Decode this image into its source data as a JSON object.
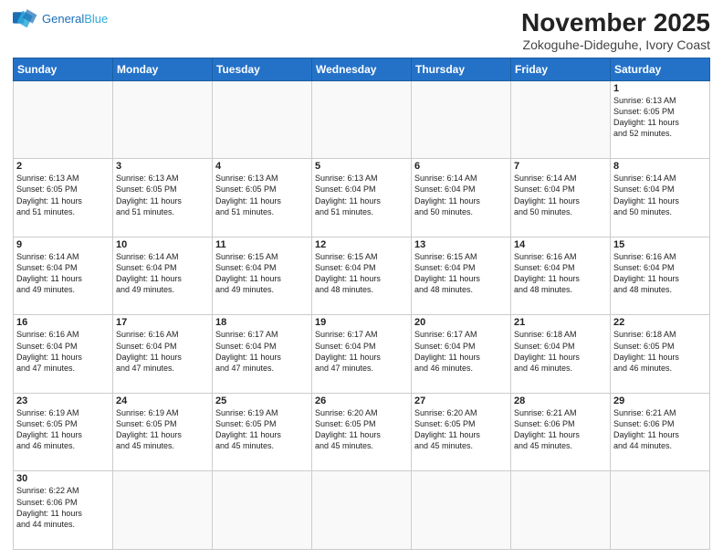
{
  "header": {
    "logo_line1": "General",
    "logo_line2": "Blue",
    "title": "November 2025",
    "subtitle": "Zokoguhe-Dideguhe, Ivory Coast"
  },
  "weekdays": [
    "Sunday",
    "Monday",
    "Tuesday",
    "Wednesday",
    "Thursday",
    "Friday",
    "Saturday"
  ],
  "weeks": [
    [
      {
        "day": "",
        "info": ""
      },
      {
        "day": "",
        "info": ""
      },
      {
        "day": "",
        "info": ""
      },
      {
        "day": "",
        "info": ""
      },
      {
        "day": "",
        "info": ""
      },
      {
        "day": "",
        "info": ""
      },
      {
        "day": "1",
        "info": "Sunrise: 6:13 AM\nSunset: 6:05 PM\nDaylight: 11 hours\nand 52 minutes."
      }
    ],
    [
      {
        "day": "2",
        "info": "Sunrise: 6:13 AM\nSunset: 6:05 PM\nDaylight: 11 hours\nand 51 minutes."
      },
      {
        "day": "3",
        "info": "Sunrise: 6:13 AM\nSunset: 6:05 PM\nDaylight: 11 hours\nand 51 minutes."
      },
      {
        "day": "4",
        "info": "Sunrise: 6:13 AM\nSunset: 6:05 PM\nDaylight: 11 hours\nand 51 minutes."
      },
      {
        "day": "5",
        "info": "Sunrise: 6:13 AM\nSunset: 6:04 PM\nDaylight: 11 hours\nand 51 minutes."
      },
      {
        "day": "6",
        "info": "Sunrise: 6:14 AM\nSunset: 6:04 PM\nDaylight: 11 hours\nand 50 minutes."
      },
      {
        "day": "7",
        "info": "Sunrise: 6:14 AM\nSunset: 6:04 PM\nDaylight: 11 hours\nand 50 minutes."
      },
      {
        "day": "8",
        "info": "Sunrise: 6:14 AM\nSunset: 6:04 PM\nDaylight: 11 hours\nand 50 minutes."
      }
    ],
    [
      {
        "day": "9",
        "info": "Sunrise: 6:14 AM\nSunset: 6:04 PM\nDaylight: 11 hours\nand 49 minutes."
      },
      {
        "day": "10",
        "info": "Sunrise: 6:14 AM\nSunset: 6:04 PM\nDaylight: 11 hours\nand 49 minutes."
      },
      {
        "day": "11",
        "info": "Sunrise: 6:15 AM\nSunset: 6:04 PM\nDaylight: 11 hours\nand 49 minutes."
      },
      {
        "day": "12",
        "info": "Sunrise: 6:15 AM\nSunset: 6:04 PM\nDaylight: 11 hours\nand 48 minutes."
      },
      {
        "day": "13",
        "info": "Sunrise: 6:15 AM\nSunset: 6:04 PM\nDaylight: 11 hours\nand 48 minutes."
      },
      {
        "day": "14",
        "info": "Sunrise: 6:16 AM\nSunset: 6:04 PM\nDaylight: 11 hours\nand 48 minutes."
      },
      {
        "day": "15",
        "info": "Sunrise: 6:16 AM\nSunset: 6:04 PM\nDaylight: 11 hours\nand 48 minutes."
      }
    ],
    [
      {
        "day": "16",
        "info": "Sunrise: 6:16 AM\nSunset: 6:04 PM\nDaylight: 11 hours\nand 47 minutes."
      },
      {
        "day": "17",
        "info": "Sunrise: 6:16 AM\nSunset: 6:04 PM\nDaylight: 11 hours\nand 47 minutes."
      },
      {
        "day": "18",
        "info": "Sunrise: 6:17 AM\nSunset: 6:04 PM\nDaylight: 11 hours\nand 47 minutes."
      },
      {
        "day": "19",
        "info": "Sunrise: 6:17 AM\nSunset: 6:04 PM\nDaylight: 11 hours\nand 47 minutes."
      },
      {
        "day": "20",
        "info": "Sunrise: 6:17 AM\nSunset: 6:04 PM\nDaylight: 11 hours\nand 46 minutes."
      },
      {
        "day": "21",
        "info": "Sunrise: 6:18 AM\nSunset: 6:04 PM\nDaylight: 11 hours\nand 46 minutes."
      },
      {
        "day": "22",
        "info": "Sunrise: 6:18 AM\nSunset: 6:05 PM\nDaylight: 11 hours\nand 46 minutes."
      }
    ],
    [
      {
        "day": "23",
        "info": "Sunrise: 6:19 AM\nSunset: 6:05 PM\nDaylight: 11 hours\nand 46 minutes."
      },
      {
        "day": "24",
        "info": "Sunrise: 6:19 AM\nSunset: 6:05 PM\nDaylight: 11 hours\nand 45 minutes."
      },
      {
        "day": "25",
        "info": "Sunrise: 6:19 AM\nSunset: 6:05 PM\nDaylight: 11 hours\nand 45 minutes."
      },
      {
        "day": "26",
        "info": "Sunrise: 6:20 AM\nSunset: 6:05 PM\nDaylight: 11 hours\nand 45 minutes."
      },
      {
        "day": "27",
        "info": "Sunrise: 6:20 AM\nSunset: 6:05 PM\nDaylight: 11 hours\nand 45 minutes."
      },
      {
        "day": "28",
        "info": "Sunrise: 6:21 AM\nSunset: 6:06 PM\nDaylight: 11 hours\nand 45 minutes."
      },
      {
        "day": "29",
        "info": "Sunrise: 6:21 AM\nSunset: 6:06 PM\nDaylight: 11 hours\nand 44 minutes."
      }
    ],
    [
      {
        "day": "30",
        "info": "Sunrise: 6:22 AM\nSunset: 6:06 PM\nDaylight: 11 hours\nand 44 minutes."
      },
      {
        "day": "",
        "info": ""
      },
      {
        "day": "",
        "info": ""
      },
      {
        "day": "",
        "info": ""
      },
      {
        "day": "",
        "info": ""
      },
      {
        "day": "",
        "info": ""
      },
      {
        "day": "",
        "info": ""
      }
    ]
  ]
}
